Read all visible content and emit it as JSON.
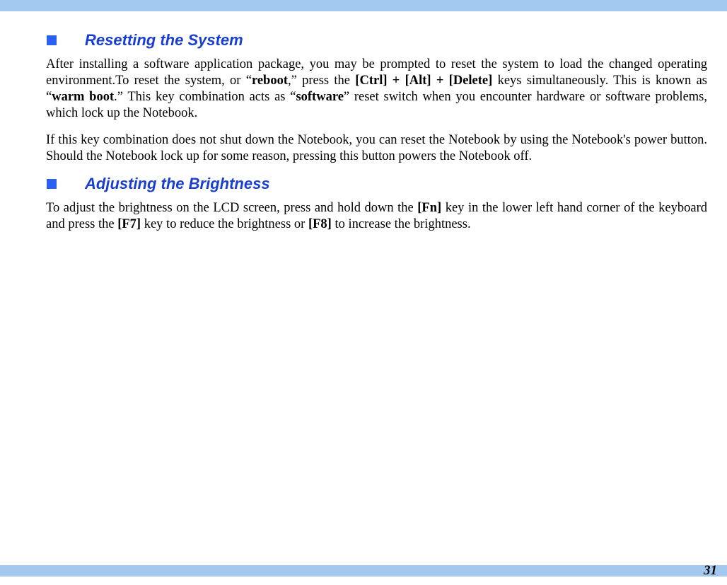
{
  "sections": [
    {
      "heading": "Resetting the System",
      "paragraphs": [
        {
          "segments": [
            {
              "text": "After installing a software application package, you may be prompted to reset the system to load the changed operating environment.To reset the system, or “",
              "bold": false
            },
            {
              "text": "reboot",
              "bold": true
            },
            {
              "text": ",” press the ",
              "bold": false
            },
            {
              "text": "[Ctrl] + [Alt] + [Delete]",
              "bold": true
            },
            {
              "text": " keys simultaneously. This is known as “",
              "bold": false
            },
            {
              "text": "warm boot",
              "bold": true
            },
            {
              "text": ".” This key combination acts as “",
              "bold": false
            },
            {
              "text": "software",
              "bold": true
            },
            {
              "text": "” reset switch when you encounter hardware or software problems, which lock up the Notebook.",
              "bold": false
            }
          ]
        },
        {
          "segments": [
            {
              "text": "If this key combination does not shut down the Notebook, you can reset the Notebook by using the Notebook's power button. Should the Notebook lock up for some reason, pressing this button powers the Notebook off.",
              "bold": false
            }
          ]
        }
      ]
    },
    {
      "heading": "Adjusting the Brightness",
      "paragraphs": [
        {
          "segments": [
            {
              "text": "To adjust the brightness on the LCD screen, press and hold down the ",
              "bold": false
            },
            {
              "text": "[Fn]",
              "bold": true
            },
            {
              "text": " key in the lower left hand corner of the keyboard and press the ",
              "bold": false
            },
            {
              "text": "[F7]",
              "bold": true
            },
            {
              "text": " key to reduce the brightness or ",
              "bold": false
            },
            {
              "text": "[F8]",
              "bold": true
            },
            {
              "text": " to increase the brightness.",
              "bold": false
            }
          ]
        }
      ]
    }
  ],
  "pageNumber": "31"
}
